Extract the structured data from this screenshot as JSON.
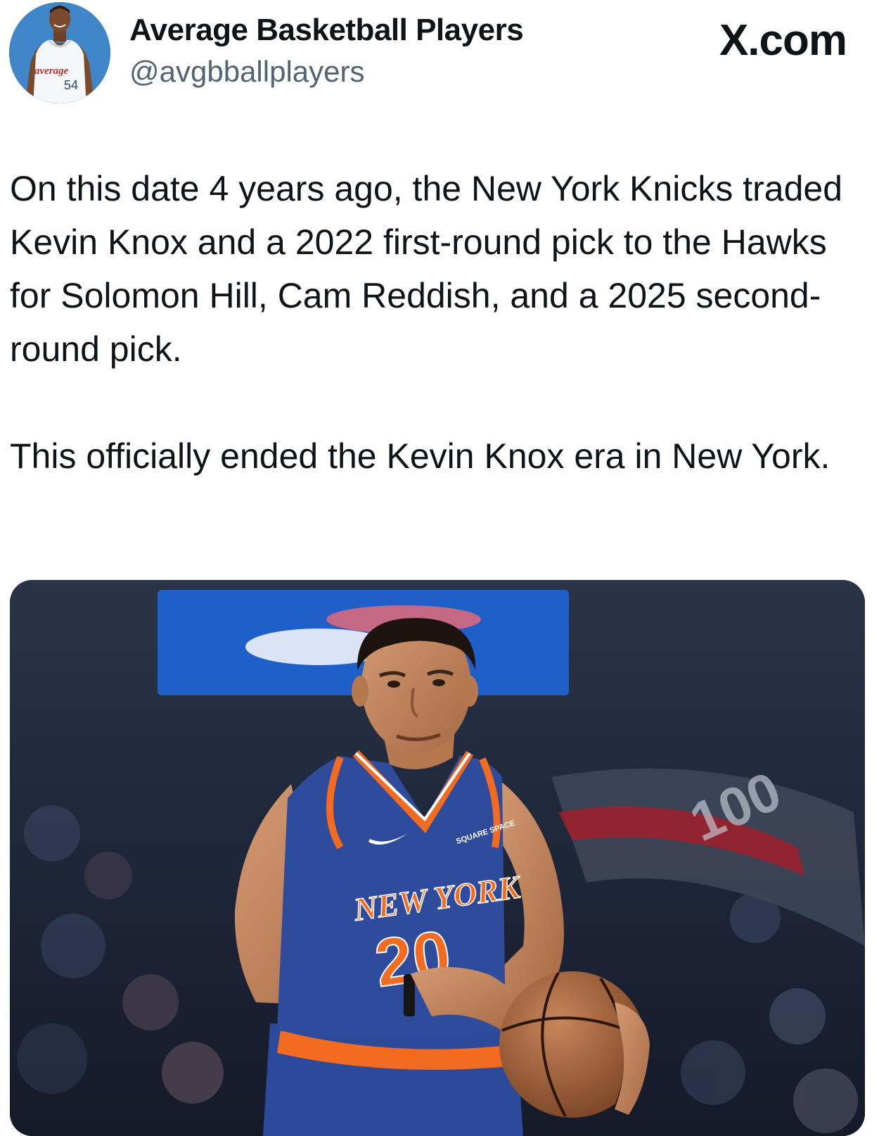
{
  "author": {
    "name": "Average Basketball Players",
    "handle": "@avgbballplayers",
    "avatar": {
      "jersey_word": "average",
      "jersey_number": "54"
    }
  },
  "site_label": "X.com",
  "post": {
    "paragraphs": [
      "On this date 4 years ago, the New York Knicks traded Kevin Knox and a 2022 first-round pick to the Hawks for Solomon Hill, Cam Reddish, and a 2025 second-round pick.",
      "This officially ended the Kevin Knox era in New York."
    ]
  },
  "media": {
    "jersey_text": "NEW YORK",
    "jersey_number": "20",
    "sponsor_patch": "SQUARE SPACE",
    "arena_text": "100"
  },
  "colors": {
    "text_primary": "#0f1419",
    "text_secondary": "#536471",
    "avatar_bg": "#3f86c8",
    "knicks_blue": "#2f4c9c",
    "knicks_orange": "#f26b21"
  }
}
